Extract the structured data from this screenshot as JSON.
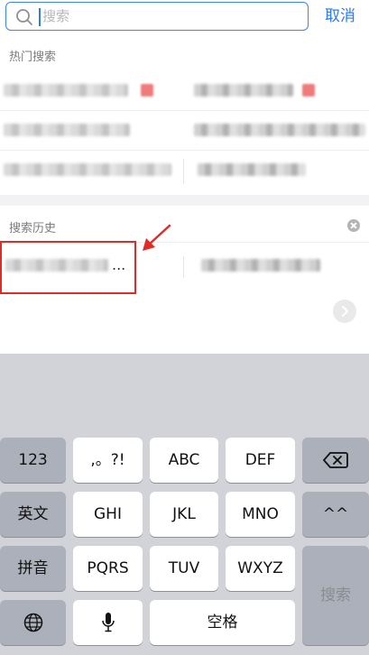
{
  "search": {
    "placeholder": "搜索",
    "cancel_label": "取消"
  },
  "hot_search": {
    "title": "热门搜索",
    "items_blurred": 6
  },
  "history": {
    "title": "搜索历史",
    "first_item_suffix": "..."
  },
  "keyboard": {
    "row1": [
      "123",
      ",。?!",
      "ABC",
      "DEF"
    ],
    "row2": [
      "英文",
      "GHI",
      "JKL",
      "MNO",
      "^^"
    ],
    "row3": [
      "拼音",
      "PQRS",
      "TUV",
      "WXYZ"
    ],
    "search_key": "搜索",
    "space_key": "空格"
  },
  "colors": {
    "accent": "#2a7af6",
    "annotation": "#e02b26",
    "keyboard_bg": "#d1d3d9"
  },
  "icons": [
    "search-icon",
    "clear-history-icon",
    "chevron-right-icon",
    "backspace-icon",
    "globe-icon",
    "microphone-icon"
  ]
}
